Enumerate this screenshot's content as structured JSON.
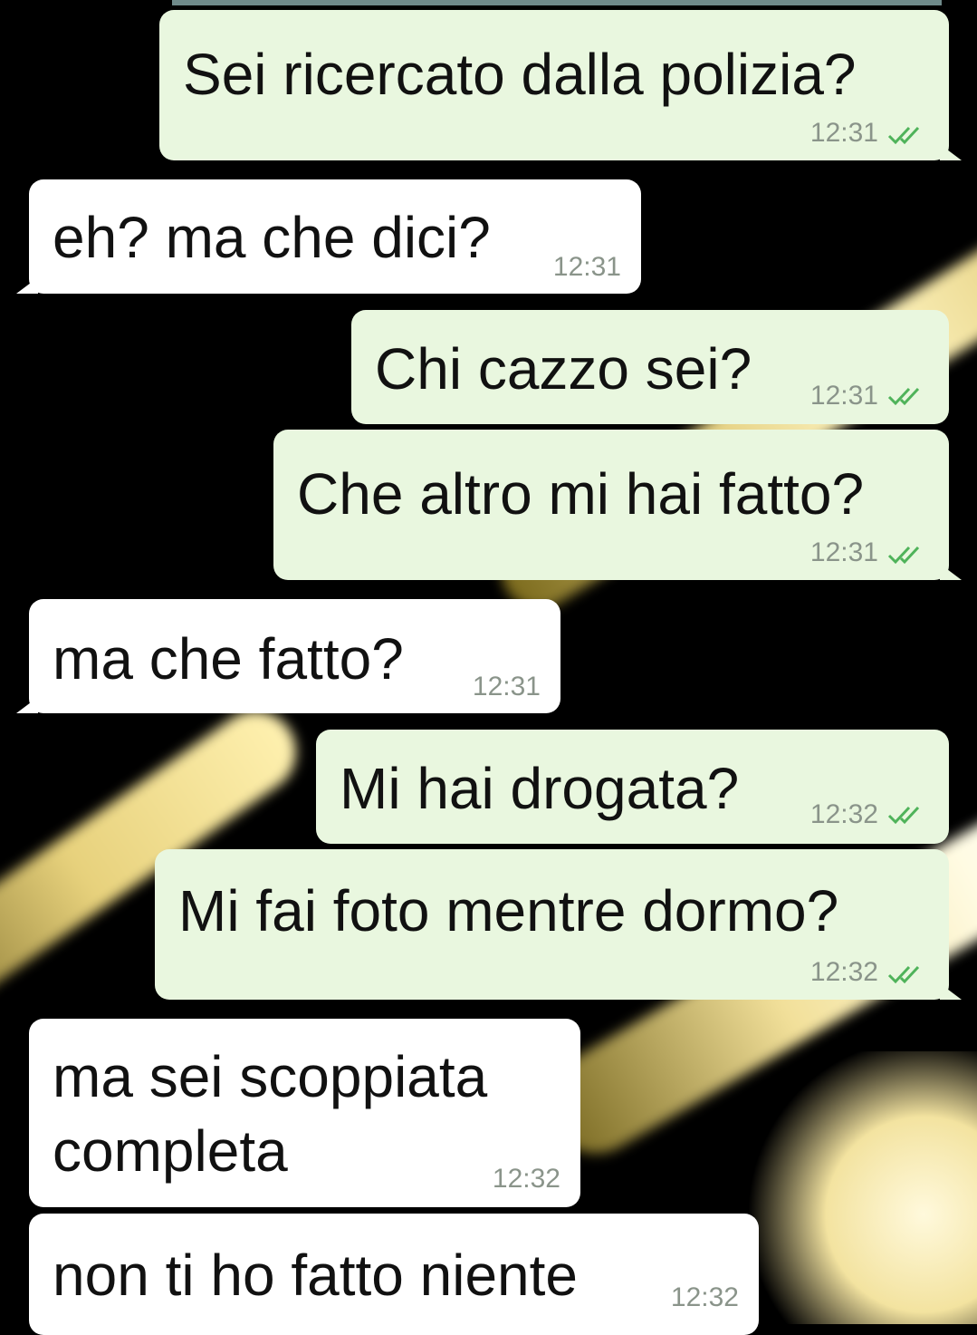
{
  "colors": {
    "outgoing_bubble": "#e9f7df",
    "incoming_bubble": "#ffffff",
    "timestamp": "#8a948a",
    "read_ticks": "#4fb35a",
    "background": "#000000"
  },
  "messages": [
    {
      "direction": "outgoing",
      "text": "Sei ricercato dalla polizia?",
      "time": "12:31",
      "status_icon": "double-check-icon"
    },
    {
      "direction": "incoming",
      "text": "eh? ma che dici?",
      "time": "12:31"
    },
    {
      "direction": "outgoing",
      "text": "Chi cazzo sei?",
      "time": "12:31",
      "status_icon": "double-check-icon"
    },
    {
      "direction": "outgoing",
      "text": "Che altro mi hai fatto?",
      "time": "12:31",
      "status_icon": "double-check-icon"
    },
    {
      "direction": "incoming",
      "text": "ma che fatto?",
      "time": "12:31"
    },
    {
      "direction": "outgoing",
      "text": "Mi hai drogata?",
      "time": "12:32",
      "status_icon": "double-check-icon"
    },
    {
      "direction": "outgoing",
      "text": "Mi fai foto mentre dormo?",
      "time": "12:32",
      "status_icon": "double-check-icon"
    },
    {
      "direction": "incoming",
      "text": "ma sei scoppiata\ncompleta",
      "time": "12:32"
    },
    {
      "direction": "incoming",
      "text": "non ti ho fatto niente",
      "time": "12:32"
    }
  ]
}
